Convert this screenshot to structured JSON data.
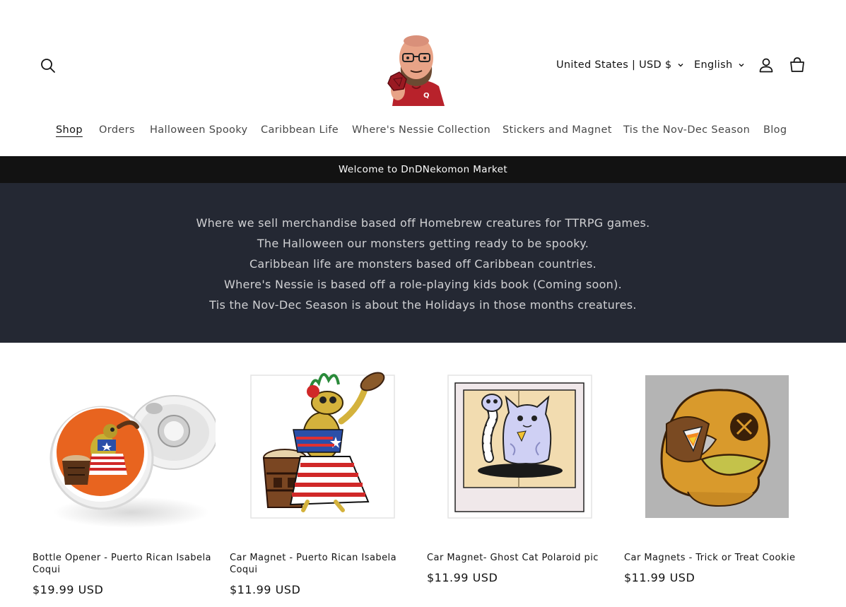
{
  "header": {
    "country_selector": "United States | USD $",
    "language_selector": "English"
  },
  "nav": {
    "items": [
      {
        "label": "Shop"
      },
      {
        "label": "Orders"
      },
      {
        "label": "Halloween Spooky"
      },
      {
        "label": "Caribbean Life"
      },
      {
        "label": "Where's Nessie Collection"
      },
      {
        "label": "Stickers and Magnet"
      },
      {
        "label": "Tis the Nov-Dec Season"
      },
      {
        "label": "Blog"
      }
    ]
  },
  "announcement": "Welcome to DnDNekomon Market",
  "banner": {
    "lines": [
      "Where we sell merchandise based off Homebrew creatures for TTRPG games.",
      "The Halloween our monsters getting ready to be spooky.",
      "Caribbean life are monsters based off Caribbean countries.",
      "Where's Nessie is based off a role-playing kids book (Coming soon).",
      "Tis the Nov-Dec Season is about the Holidays in those months creatures."
    ]
  },
  "products": [
    {
      "title": "Bottle Opener - Puerto Rican Isabela Coqui",
      "price": "$19.99 USD",
      "image_icon": "bottle-opener-coqui-image"
    },
    {
      "title": "Car Magnet - Puerto Rican Isabela Coqui",
      "price": "$11.99 USD",
      "image_icon": "coqui-drummer-image"
    },
    {
      "title": "Car Magnet- Ghost Cat Polaroid pic",
      "price": "$11.99 USD",
      "image_icon": "ghost-cat-polaroid-image"
    },
    {
      "title": "Car Magnets - Trick or Treat Cookie",
      "price": "$11.99 USD",
      "image_icon": "trick-or-treat-cookie-image"
    }
  ],
  "colors": {
    "announcement_bg": "#121212",
    "banner_bg": "#242833",
    "text": "#121212"
  }
}
